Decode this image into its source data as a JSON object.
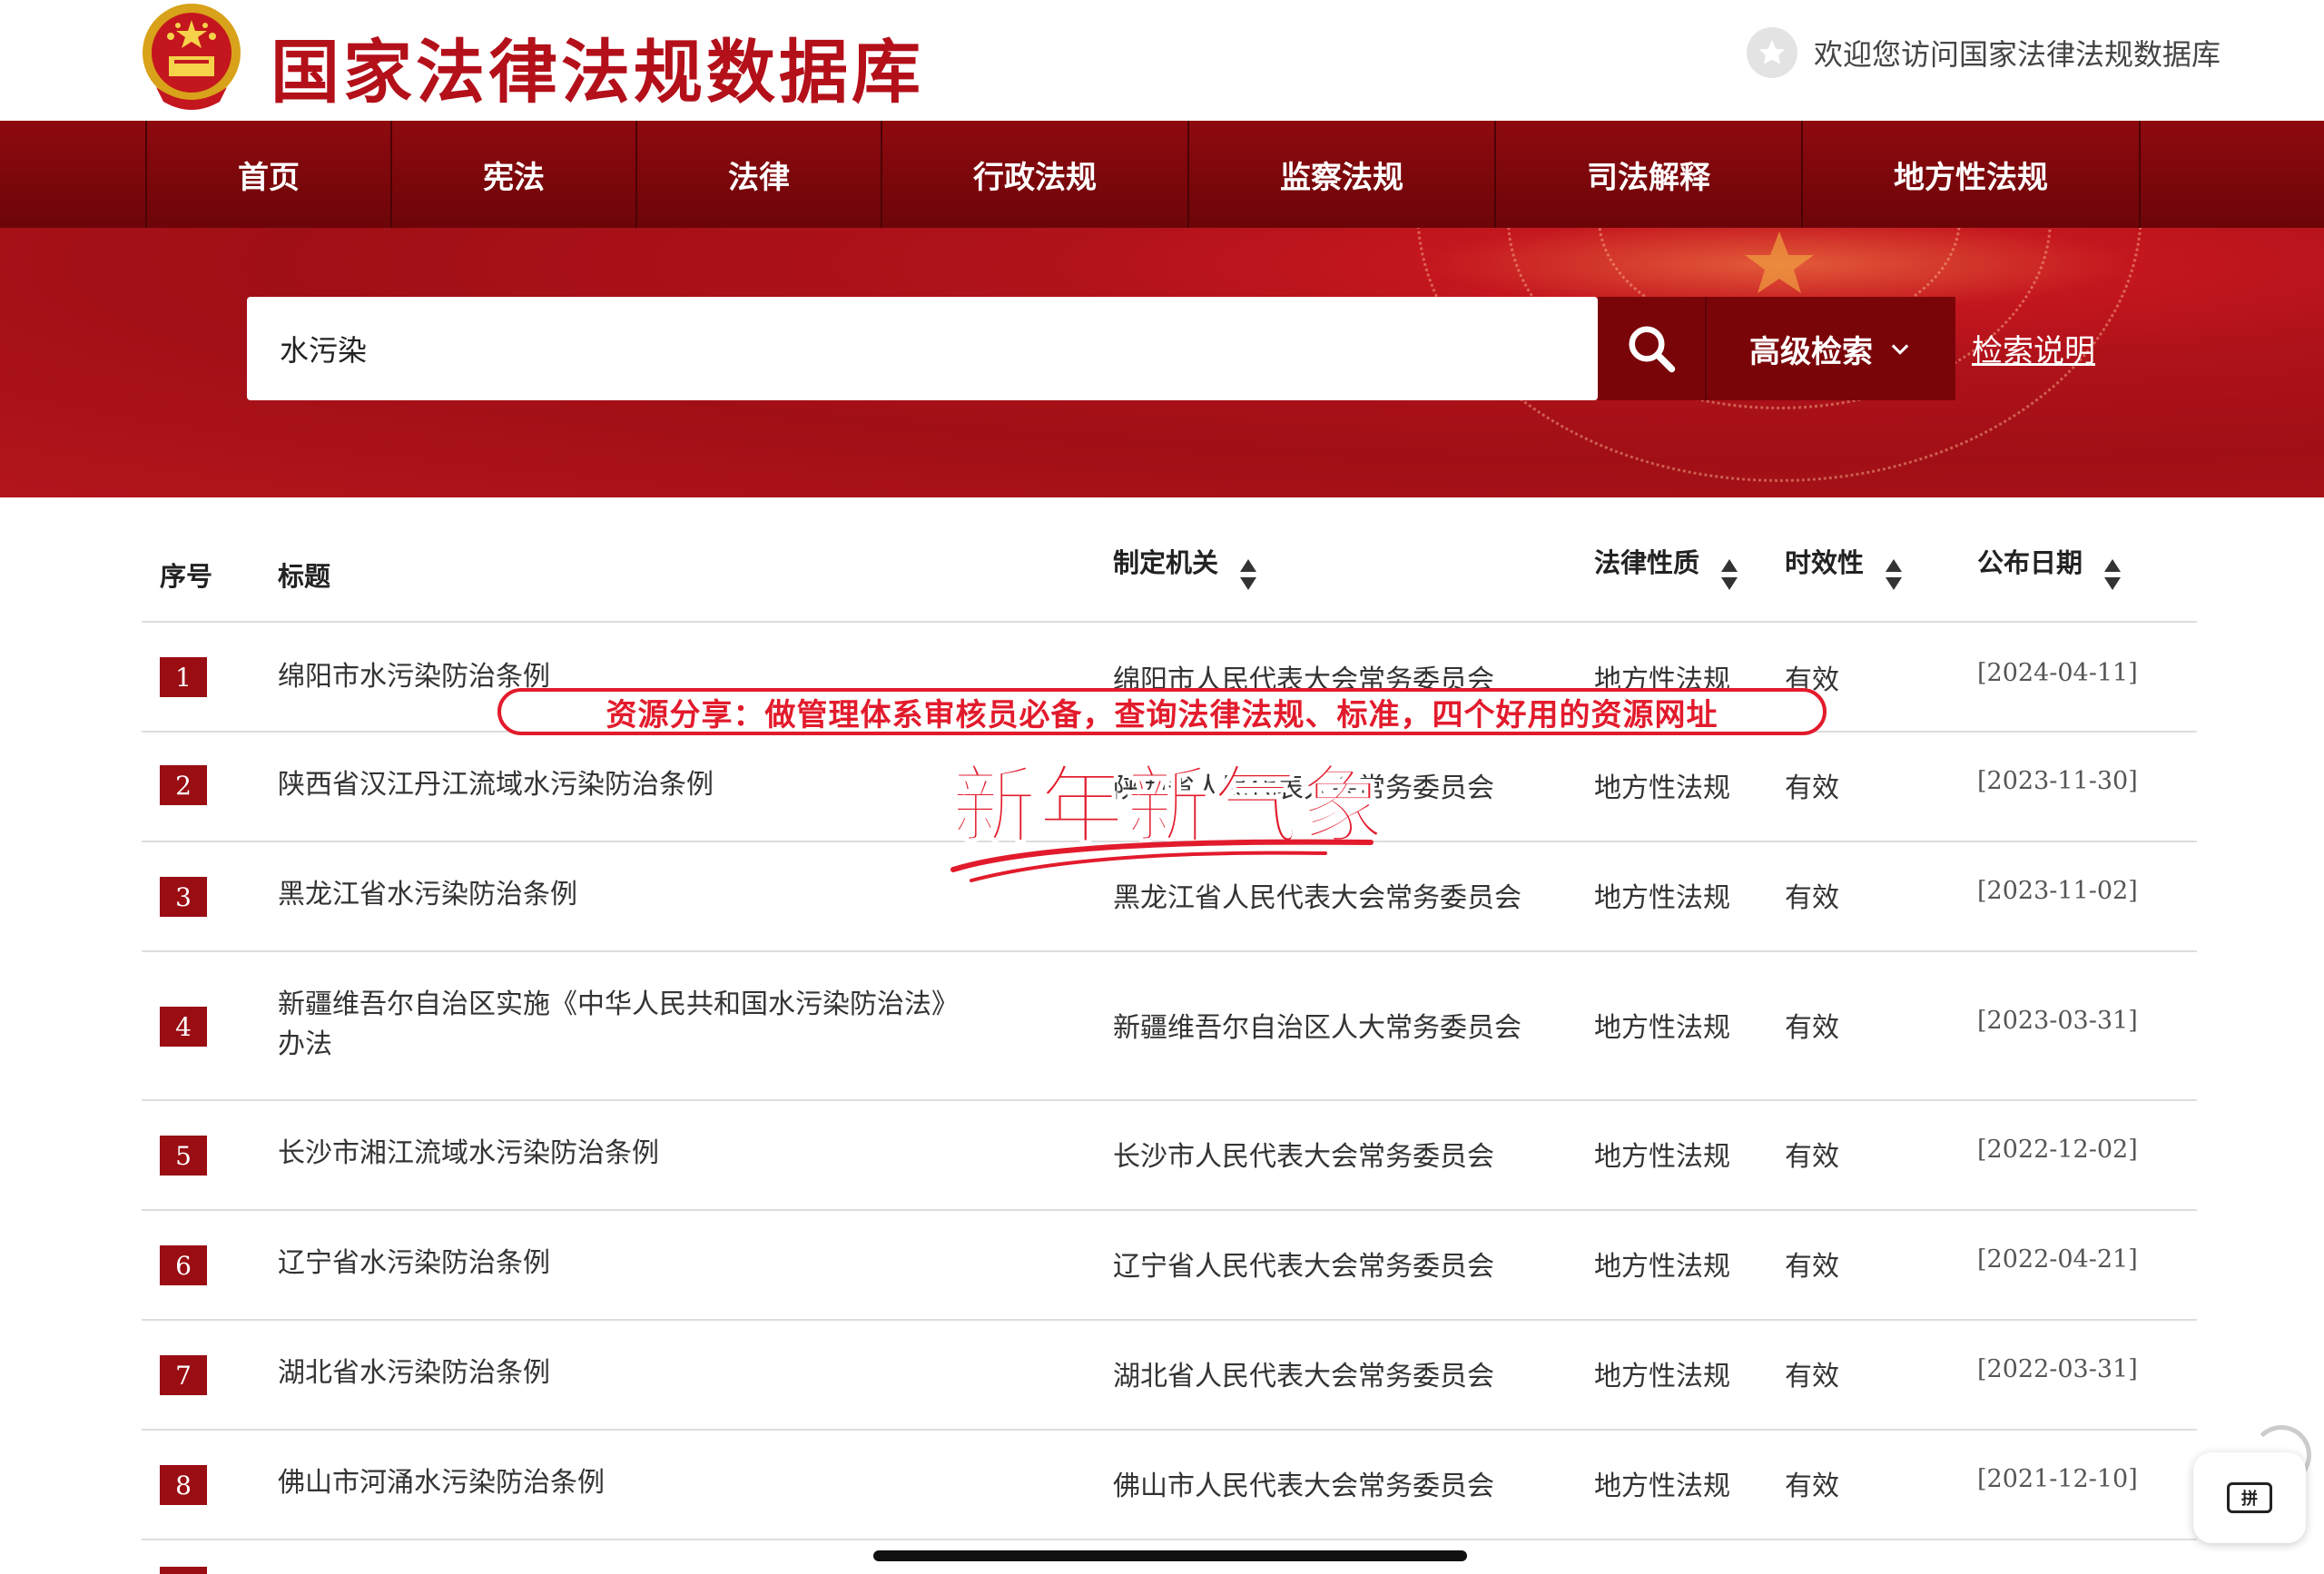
{
  "header": {
    "site_title": "国家法律法规数据库",
    "welcome": "欢迎您访问国家法律法规数据库",
    "emblem_icon": "national-emblem-icon",
    "star_icon": "star-icon"
  },
  "nav": {
    "items": [
      {
        "label": "首页"
      },
      {
        "label": "宪法"
      },
      {
        "label": "法律"
      },
      {
        "label": "行政法规"
      },
      {
        "label": "监察法规"
      },
      {
        "label": "司法解释"
      },
      {
        "label": "地方性法规"
      }
    ]
  },
  "search": {
    "value": "水污染",
    "advanced_label": "高级检索",
    "help_label": "检索说明"
  },
  "table": {
    "headers": {
      "index": "序号",
      "title": "标题",
      "org": "制定机关",
      "nature": "法律性质",
      "validity": "时效性",
      "date": "公布日期"
    },
    "rows": [
      {
        "index": "1",
        "title": "绵阳市水污染防治条例",
        "org": "绵阳市人民代表大会常务委员会",
        "nature": "地方性法规",
        "validity": "有效",
        "date": "[2024-04-11]"
      },
      {
        "index": "2",
        "title": "陕西省汉江丹江流域水污染防治条例",
        "org": "陕西省人民代表大会常务委员会",
        "nature": "地方性法规",
        "validity": "有效",
        "date": "[2023-11-30]"
      },
      {
        "index": "3",
        "title": "黑龙江省水污染防治条例",
        "org": "黑龙江省人民代表大会常务委员会",
        "nature": "地方性法规",
        "validity": "有效",
        "date": "[2023-11-02]"
      },
      {
        "index": "4",
        "title": "新疆维吾尔自治区实施《中华人民共和国水污染防治法》办法",
        "org": "新疆维吾尔自治区人大常务委员会",
        "nature": "地方性法规",
        "validity": "有效",
        "date": "[2023-03-31]"
      },
      {
        "index": "5",
        "title": "长沙市湘江流域水污染防治条例",
        "org": "长沙市人民代表大会常务委员会",
        "nature": "地方性法规",
        "validity": "有效",
        "date": "[2022-12-02]"
      },
      {
        "index": "6",
        "title": "辽宁省水污染防治条例",
        "org": "辽宁省人民代表大会常务委员会",
        "nature": "地方性法规",
        "validity": "有效",
        "date": "[2022-04-21]"
      },
      {
        "index": "7",
        "title": "湖北省水污染防治条例",
        "org": "湖北省人民代表大会常务委员会",
        "nature": "地方性法规",
        "validity": "有效",
        "date": "[2022-03-31]"
      },
      {
        "index": "8",
        "title": "佛山市河涌水污染防治条例",
        "org": "佛山市人民代表大会常务委员会",
        "nature": "地方性法规",
        "validity": "有效",
        "date": "[2021-12-10]"
      }
    ]
  },
  "overlay": {
    "promo": "资源分享：做管理体系审核员必备，查询法律法规、标准，四个好用的资源网址",
    "headline": "新年新气象"
  },
  "ime": {
    "label": "拼"
  },
  "colors": {
    "brand_red": "#b3101a",
    "nav_dark": "#7a0509",
    "overlay_red": "#e21b2c"
  }
}
